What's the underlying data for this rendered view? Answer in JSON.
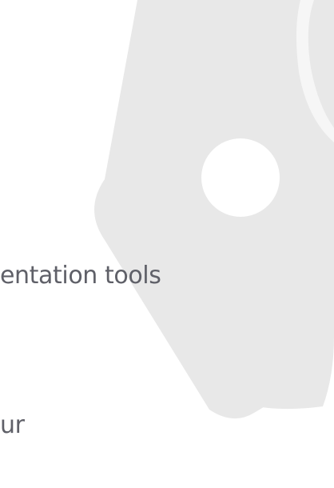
{
  "content": {
    "lines": [
      "entation tools",
      "ur"
    ]
  },
  "watermark": {
    "icon": "rounded-diamond-logo-icon",
    "color": "#e8e8e8"
  }
}
